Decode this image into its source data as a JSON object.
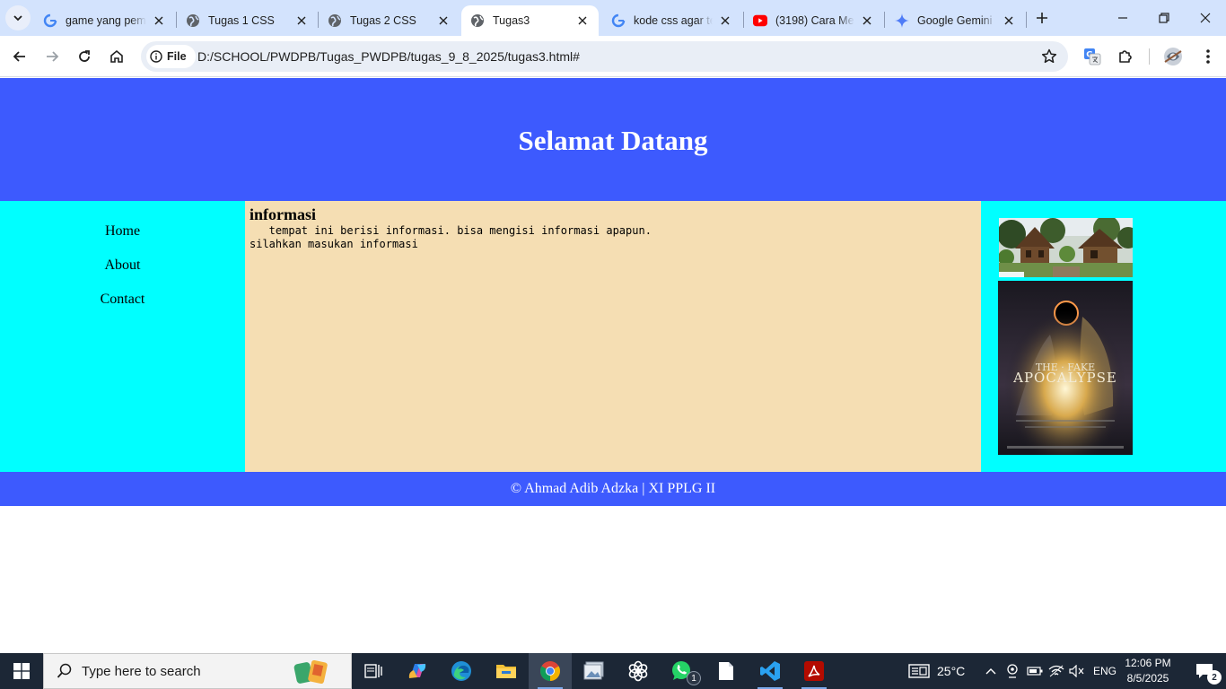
{
  "browser": {
    "tabs": [
      {
        "label": "game yang pemi",
        "favicon": "google-icon",
        "active": false
      },
      {
        "label": "Tugas 1 CSS",
        "favicon": "globe-icon",
        "active": false
      },
      {
        "label": "Tugas 2 CSS",
        "favicon": "globe-icon",
        "active": false
      },
      {
        "label": "Tugas3",
        "favicon": "globe-icon",
        "active": true
      },
      {
        "label": "kode css agar te",
        "favicon": "google-icon",
        "active": false
      },
      {
        "label": "(3198) Cara Men",
        "favicon": "youtube-icon",
        "active": false
      },
      {
        "label": "Google Gemini",
        "favicon": "gemini-icon",
        "active": false
      }
    ],
    "address": {
      "chip_label": "File",
      "url": "D:/SCHOOL/PWDPB/Tugas_PWDPB/tugas_9_8_2025/tugas3.html#"
    }
  },
  "page": {
    "header_title": "Selamat Datang",
    "nav": [
      "Home",
      "About",
      "Contact"
    ],
    "content": {
      "heading": "informasi",
      "body": "   tempat ini berisi informasi. bisa mengisi informasi apapun.\nsilahkan masukan informasi"
    },
    "aside_images": [
      "house-photo",
      "the-apocalypse-poster"
    ],
    "footer": "© Ahmad Adib Adzka | XI PPLG II"
  },
  "taskbar": {
    "search_placeholder": "Type here to search",
    "weather": "25°C",
    "language": "ENG",
    "time": "12:06 PM",
    "date": "8/5/2025",
    "whatsapp_badge": "1",
    "notification_count": "2"
  },
  "colors": {
    "header_bg": "#3d5afe",
    "sidebar_bg": "#00ffff",
    "content_bg": "#f5deb3",
    "tabstrip_bg": "#d3e3fd"
  }
}
